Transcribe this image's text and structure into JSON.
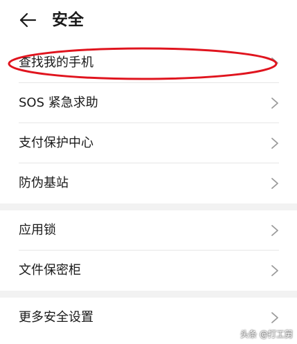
{
  "header": {
    "title": "安全",
    "back_icon": "arrow-left-icon"
  },
  "groups": [
    {
      "items": [
        {
          "label": "查找我的手机",
          "highlighted": true
        },
        {
          "label": "SOS 紧急求助"
        },
        {
          "label": "支付保护中心"
        },
        {
          "label": "防伪基站"
        }
      ]
    },
    {
      "items": [
        {
          "label": "应用锁"
        },
        {
          "label": "文件保密柜"
        }
      ]
    },
    {
      "items": [
        {
          "label": "更多安全设置"
        }
      ]
    }
  ],
  "watermark": "头条 @打工舅",
  "colors": {
    "background": "#ffffff",
    "separator_band": "#f2f2f2",
    "divider": "#e6e6e6",
    "chevron": "#9a9a9a",
    "highlight_ellipse": "#e0141e"
  }
}
